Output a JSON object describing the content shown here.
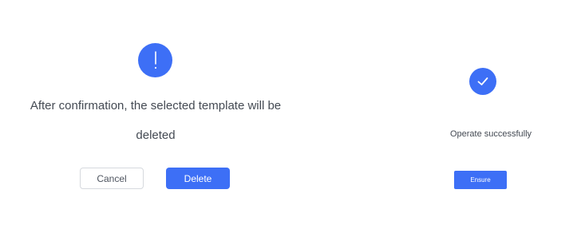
{
  "colors": {
    "accent": "#3d6ff6"
  },
  "confirm_dialog": {
    "icon": "exclamation-icon",
    "icon_glyph": "!",
    "message_line1": "After confirmation, the selected template will be",
    "message_line2": "deleted",
    "cancel_label": "Cancel",
    "delete_label": "Delete"
  },
  "success_dialog": {
    "icon": "checkmark-icon",
    "message": "Operate successfully",
    "ensure_label": "Ensure"
  }
}
